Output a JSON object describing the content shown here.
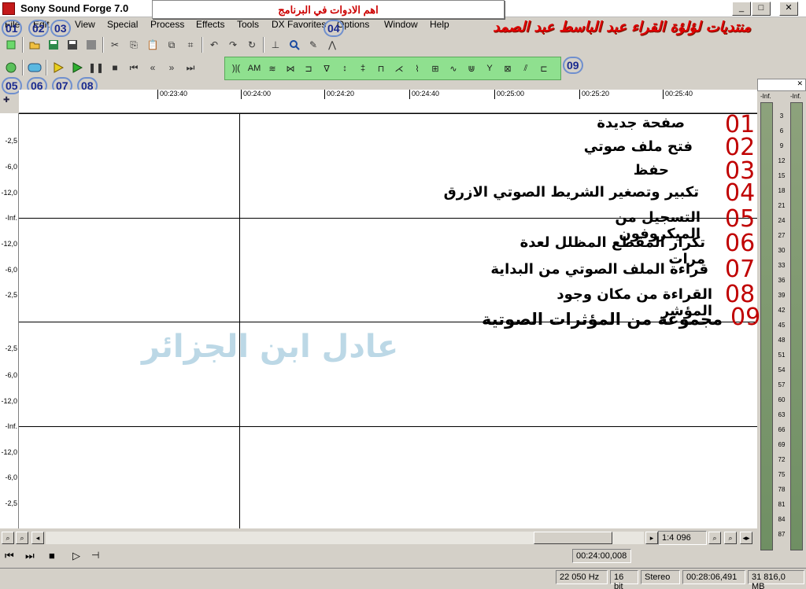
{
  "window": {
    "title": "Sony Sound Forge 7.0",
    "min": "_",
    "max": "□",
    "close": "✕"
  },
  "popup": {
    "text": "اهم الادوات في البرنامج"
  },
  "menus": [
    "File",
    "Edit",
    "View",
    "Special",
    "Process",
    "Effects",
    "Tools",
    "DX Favorites",
    "Options",
    "Window",
    "Help"
  ],
  "banner": "منتديات لؤلؤة القراء عبد الباسط عبد الصمد",
  "badges": [
    "01",
    "02",
    "03",
    "04",
    "05",
    "06",
    "07",
    "08",
    "09"
  ],
  "ruler_ticks": [
    "00:23:40",
    "00:24:00",
    "00:24:20",
    "00:24:40",
    "00:25:00",
    "00:25:20",
    "00:25:40"
  ],
  "left_scale": [
    "-2,5",
    "-6,0",
    "-12,0",
    "-Inf.",
    "-12,0",
    "-6,0",
    "-2,5",
    "-2,5",
    "-6,0",
    "-12,0",
    "-Inf.",
    "-12,0",
    "-6,0",
    "-2,5"
  ],
  "meter": {
    "left_head": "-Inf.",
    "right_head": "-Inf.",
    "ticks": [
      "3",
      "6",
      "9",
      "12",
      "15",
      "18",
      "21",
      "24",
      "27",
      "30",
      "33",
      "36",
      "39",
      "42",
      "45",
      "48",
      "51",
      "54",
      "57",
      "60",
      "63",
      "66",
      "69",
      "72",
      "75",
      "78",
      "81",
      "84",
      "87"
    ]
  },
  "annotations": [
    {
      "num": "01",
      "text": "صفحة جديدة"
    },
    {
      "num": "02",
      "text": "فتح ملف صوتي"
    },
    {
      "num": "03",
      "text": "حفظ"
    },
    {
      "num": "04",
      "text": "تكبير وتصغير الشريط الصوتي الازرق"
    },
    {
      "num": "05",
      "text": "التسجيل من الميكروفون"
    },
    {
      "num": "06",
      "text": "تكرار المقطع المظلل لعدة مرات"
    },
    {
      "num": "07",
      "text": "قراءة الملف الصوتي من البداية"
    },
    {
      "num": "08",
      "text": "القراءة من مكان وجود المؤشر"
    },
    {
      "num": "09",
      "text": "مجموعة من المؤثرات الصوتية"
    }
  ],
  "watermark": "عادل ابن الجزائر",
  "zoom": {
    "ratio": "1:4 096"
  },
  "position": {
    "cursor": "00:24:00,008"
  },
  "status": {
    "rate": "22 050 Hz",
    "bits": "16 bit",
    "channels": "Stereo",
    "length": "00:28:06,491",
    "space": "31 816,0 MB"
  }
}
